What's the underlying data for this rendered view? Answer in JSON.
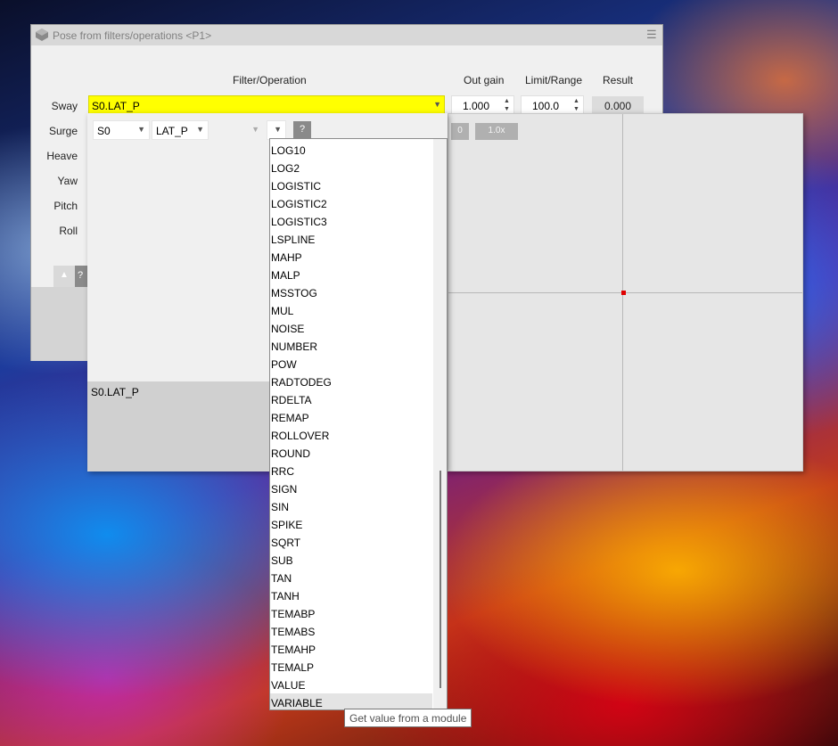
{
  "window": {
    "title": "Pose from filters/operations <P1>"
  },
  "columns": {
    "filter_op": "Filter/Operation",
    "out_gain": "Out gain",
    "limit_range": "Limit/Range",
    "result": "Result"
  },
  "rows": [
    "Sway",
    "Surge",
    "Heave",
    "Yaw",
    "Pitch",
    "Roll"
  ],
  "sway": {
    "expression": "S0.LAT_P",
    "out_gain": "1.000",
    "limit": "100.0",
    "result": "0.000"
  },
  "editor": {
    "source_combo": "S0",
    "channel_combo": "LAT_P",
    "help_label": "?",
    "expression_text": "S0.LAT_P"
  },
  "graph": {
    "zero_button": "0",
    "zoom_button": "1.0x"
  },
  "left_panel": {
    "help_label": "?"
  },
  "dropdown": {
    "items": [
      "LOG10",
      "LOG2",
      "LOGISTIC",
      "LOGISTIC2",
      "LOGISTIC3",
      "LSPLINE",
      "MAHP",
      "MALP",
      "MSSTOG",
      "MUL",
      "NOISE",
      "NUMBER",
      "POW",
      "RADTODEG",
      "RDELTA",
      "REMAP",
      "ROLLOVER",
      "ROUND",
      "RRC",
      "SIGN",
      "SIN",
      "SPIKE",
      "SQRT",
      "SUB",
      "TAN",
      "TANH",
      "TEMABP",
      "TEMABS",
      "TEMAHP",
      "TEMALP",
      "VALUE",
      "VARIABLE"
    ],
    "selected": "VARIABLE"
  },
  "tooltip": "Get value from a module",
  "colors": {
    "sway_highlight": "#ffff00",
    "marker": "#e00000"
  }
}
